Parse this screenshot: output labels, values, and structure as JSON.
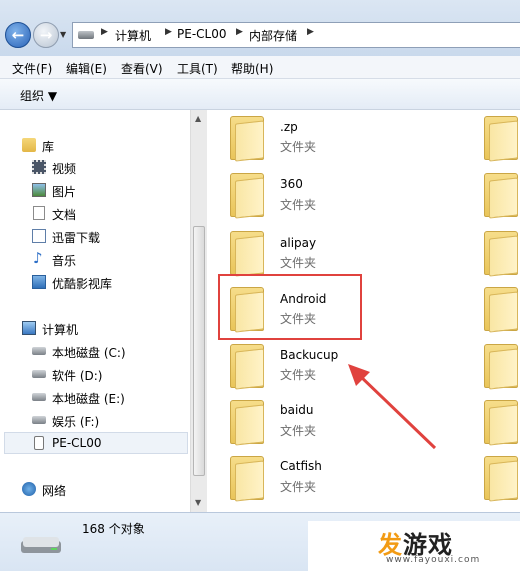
{
  "address": {
    "back_symbol": "←",
    "forward_symbol": "→",
    "recent_symbol": "▼",
    "path": [
      "计算机",
      "PE-CL00",
      "内部存储"
    ]
  },
  "menu": {
    "items": [
      "文件(F)",
      "编辑(E)",
      "查看(V)",
      "工具(T)",
      "帮助(H)"
    ]
  },
  "toolbar": {
    "organize": "组织 ▼"
  },
  "nav": {
    "library": "库",
    "library_items": [
      "视频",
      "图片",
      "文档",
      "迅雷下载",
      "音乐",
      "优酷影视库"
    ],
    "computer": "计算机",
    "drives": [
      "本地磁盘 (C:)",
      "软件 (D:)",
      "本地磁盘 (E:)",
      "娱乐 (F:)",
      "PE-CL00"
    ],
    "network": "网络"
  },
  "folder_type": "文件夹",
  "folders": [
    ".zp",
    "360",
    "alipay",
    "Android",
    "Backucup",
    "baidu",
    "Catfish"
  ],
  "status": {
    "count": "168 个对象"
  },
  "watermark": {
    "char1": "发",
    "rest": "游戏",
    "url": "www.fayouxi.com"
  },
  "colors": {
    "highlight": "#e0423e",
    "selection": "#eef3f9"
  }
}
